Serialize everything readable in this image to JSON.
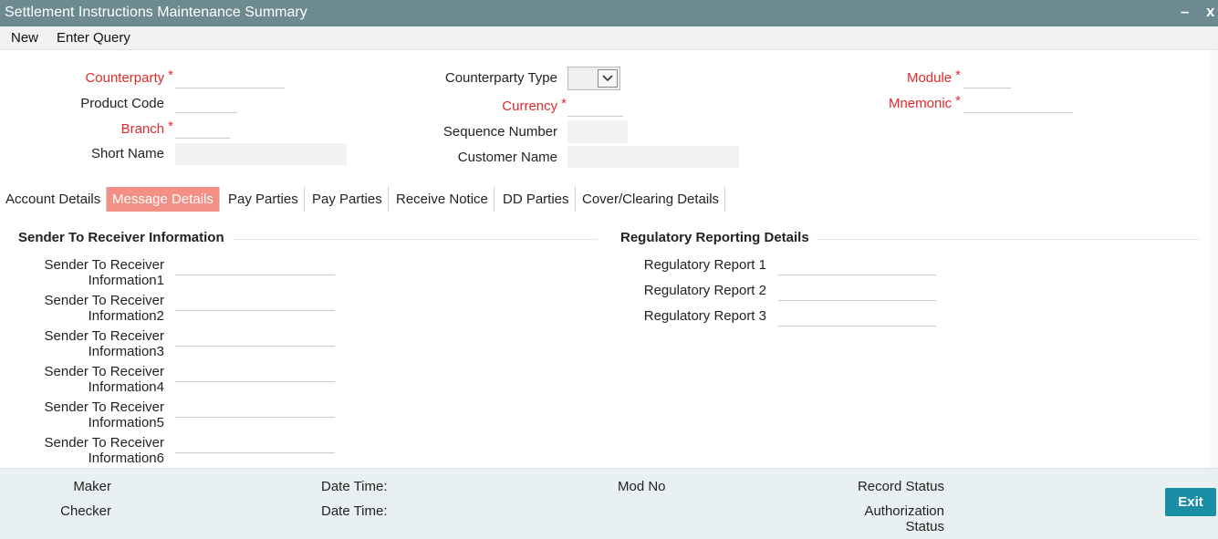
{
  "window": {
    "title": "Settlement Instructions Maintenance Summary",
    "minimize": "–",
    "close": "x"
  },
  "menu": {
    "new": "New",
    "enter_query": "Enter Query"
  },
  "header": {
    "counterparty": "Counterparty",
    "product_code": "Product Code",
    "branch": "Branch",
    "short_name": "Short Name",
    "counterparty_type": "Counterparty Type",
    "currency": "Currency",
    "sequence_number": "Sequence Number",
    "customer_name": "Customer Name",
    "module": "Module",
    "mnemonic": "Mnemonic",
    "required_marker": "*"
  },
  "tabs": [
    "Account Details",
    "Message Details",
    "Pay Parties",
    "Pay Parties",
    "Receive Notice",
    "DD Parties",
    "Cover/Clearing Details"
  ],
  "sender_section": {
    "title": "Sender To Receiver Information",
    "rows": [
      {
        "line1": "Sender To Receiver",
        "line2": "Information1"
      },
      {
        "line1": "Sender To Receiver",
        "line2": "Information2"
      },
      {
        "line1": "Sender To Receiver",
        "line2": "Information3"
      },
      {
        "line1": "Sender To Receiver",
        "line2": "Information4"
      },
      {
        "line1": "Sender To Receiver",
        "line2": "Information5"
      },
      {
        "line1": "Sender To Receiver",
        "line2": "Information6"
      }
    ]
  },
  "regulatory_section": {
    "title": "Regulatory Reporting Details",
    "rows": [
      "Regulatory Report 1",
      "Regulatory Report 2",
      "Regulatory Report 3"
    ]
  },
  "footer": {
    "maker": "Maker",
    "checker": "Checker",
    "date_time_1": "Date Time:",
    "date_time_2": "Date Time:",
    "mod_no": "Mod No",
    "record_status": "Record Status",
    "authorization_status_line1": "Authorization",
    "authorization_status_line2": "Status",
    "exit": "Exit"
  },
  "colors": {
    "titlebar": "#6c8a90",
    "active_tab": "#f48f85",
    "required": "#e02a2a",
    "exit_button": "#1a8ea5",
    "footer": "#e8f0f1"
  },
  "icons": {
    "counterparty_type_dropdown": "chevron-down-icon"
  }
}
